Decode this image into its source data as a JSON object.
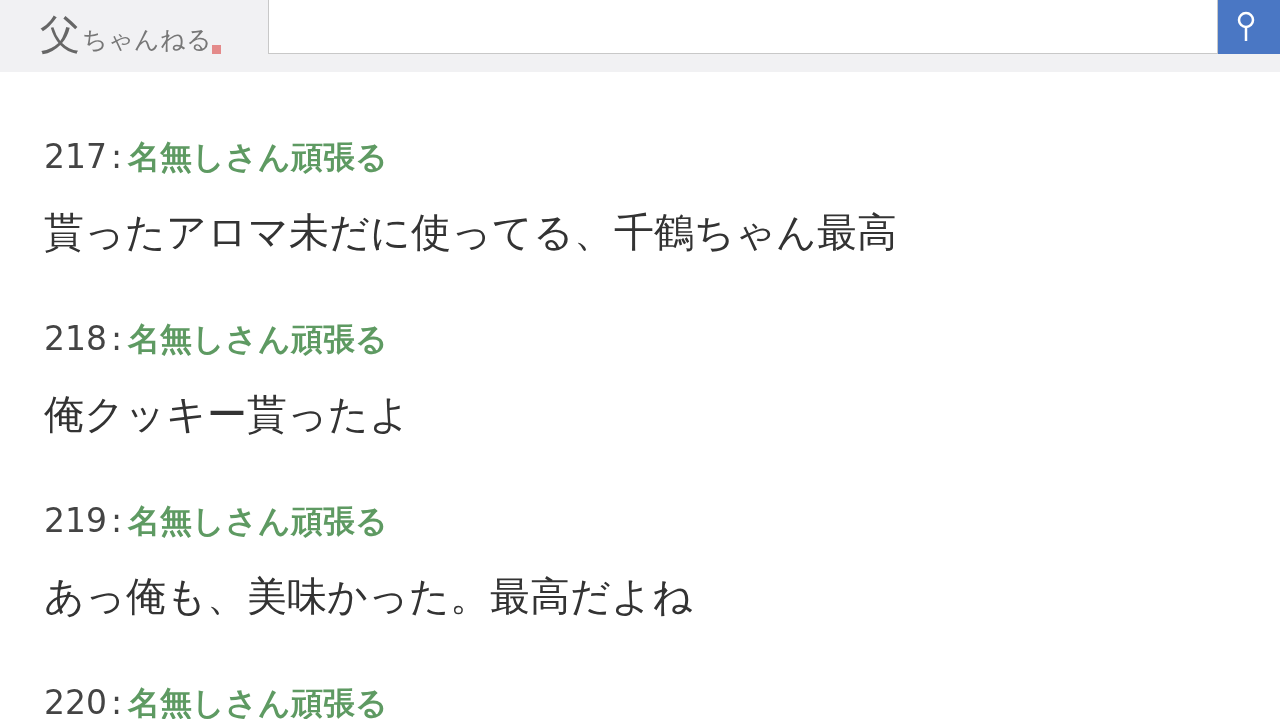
{
  "header": {
    "logo_main": "父",
    "logo_sub": "ちゃんねる"
  },
  "posts": [
    {
      "number": "217",
      "separator": ":",
      "name": "名無しさん頑張る",
      "body": "貰ったアロマ未だに使ってる、千鶴ちゃん最高"
    },
    {
      "number": "218",
      "separator": ":",
      "name": "名無しさん頑張る",
      "body": "俺クッキー貰ったよ"
    },
    {
      "number": "219",
      "separator": ":",
      "name": "名無しさん頑張る",
      "body": "あっ俺も、美味かった。最高だよね"
    },
    {
      "number": "220",
      "separator": ":",
      "name": "名無しさん頑張る"
    }
  ]
}
